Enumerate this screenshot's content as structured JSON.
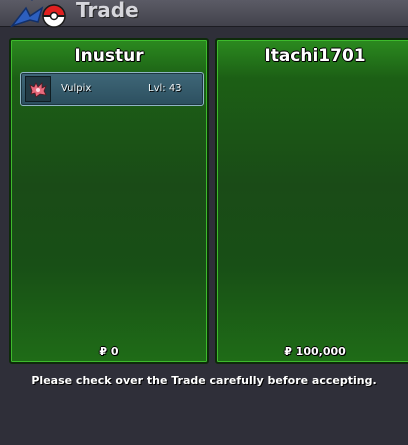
{
  "window": {
    "title": "Trade",
    "icon": "pokeball-trade-icon"
  },
  "left_panel": {
    "player_name": "Inustur",
    "items": [
      {
        "name": "Vulpix",
        "level": "Lvl: 43",
        "icon": "vulpix-sprite-icon"
      }
    ],
    "money": "₽ 0"
  },
  "right_panel": {
    "player_name": "Itachi1701",
    "items": [],
    "money": "₽ 100,000"
  },
  "footer": {
    "message": "Please check over the Trade carefully before accepting."
  },
  "colors": {
    "panel_green": "#1c5f15",
    "panel_border": "#3dbb2c",
    "item_bg": "#3f6778",
    "window_bg": "#2f2f39"
  }
}
